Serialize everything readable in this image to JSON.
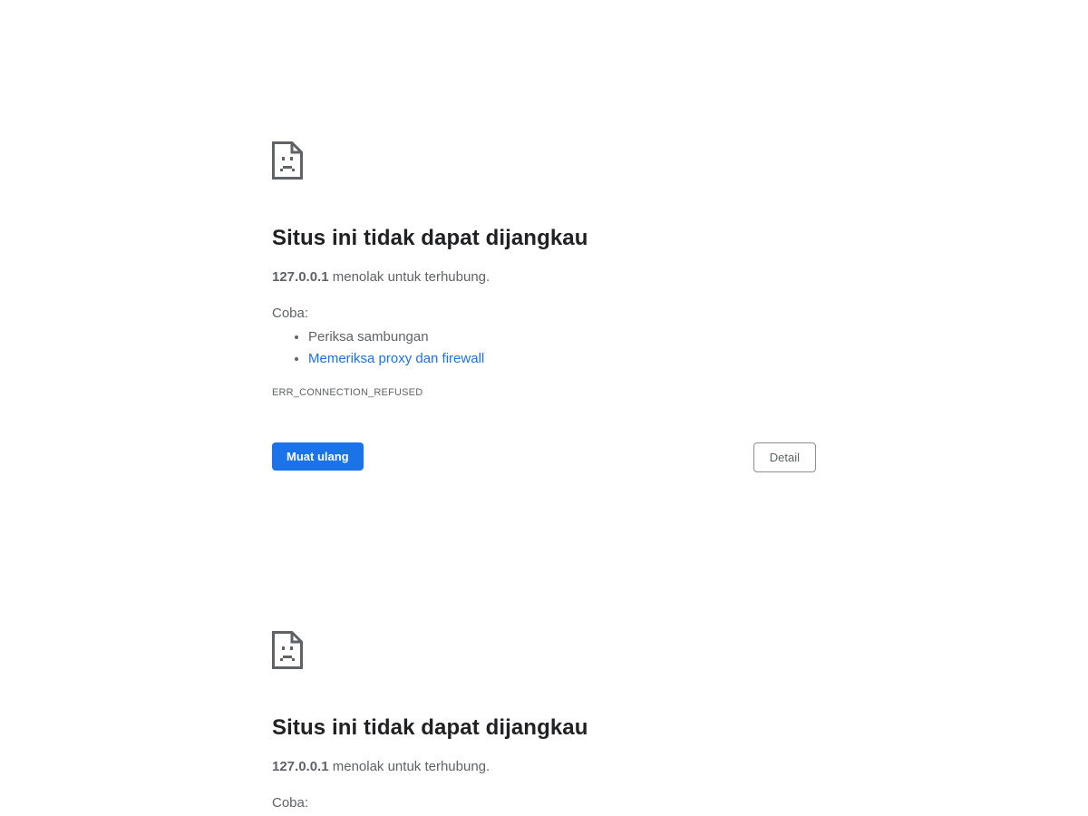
{
  "error_pages": [
    {
      "icon": "sad-page-icon",
      "title": "Situs ini tidak dapat dijangkau",
      "host": "127.0.0.1",
      "message_suffix": " menolak untuk terhubung.",
      "try_label": "Coba:",
      "suggestions": [
        {
          "label": "Periksa sambungan",
          "is_link": false
        },
        {
          "label": "Memeriksa proxy dan firewall",
          "is_link": true
        }
      ],
      "error_code": "ERR_CONNECTION_REFUSED",
      "reload_label": "Muat ulang",
      "details_label": "Detail"
    },
    {
      "icon": "sad-page-icon",
      "title": "Situs ini tidak dapat dijangkau",
      "host": "127.0.0.1",
      "message_suffix": " menolak untuk terhubung.",
      "try_label": "Coba:"
    }
  ],
  "colors": {
    "accent": "#1a73e8",
    "heading": "#202124",
    "body_text": "#5f6368",
    "icon": "#5f6368"
  }
}
